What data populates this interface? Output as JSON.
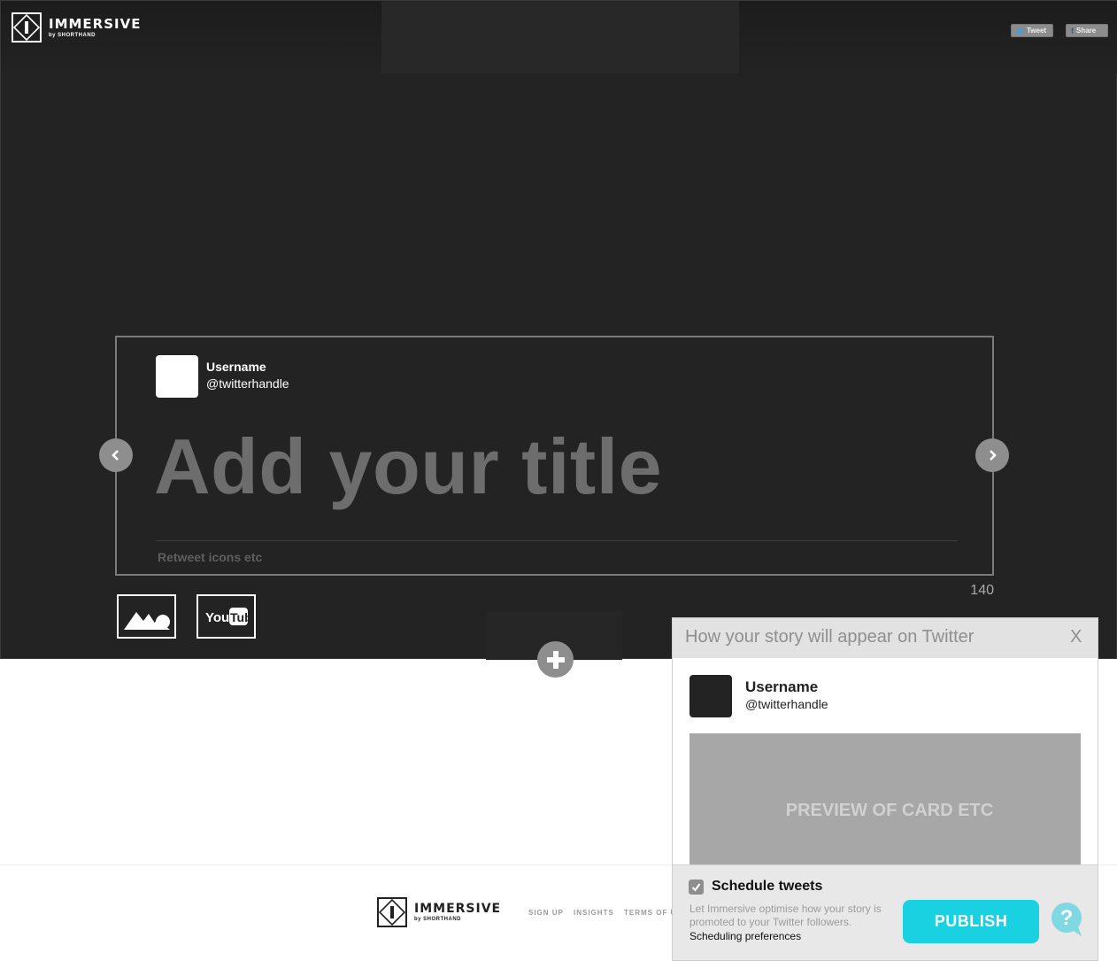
{
  "brand": {
    "name": "IMMERSIVE",
    "byline": "by SHORTHAND"
  },
  "header": {
    "tweet_label": "Tweet",
    "share_label": "Share"
  },
  "editor": {
    "username": "Username",
    "handle": "@twitterhandle",
    "title_placeholder": "Add your title",
    "footer_text": "Retweet icons etc",
    "char_count": "140",
    "youtube_label": "YouTube"
  },
  "footer": {
    "links": [
      "SIGN UP",
      "INSIGHTS",
      "TERMS OF U"
    ]
  },
  "twitter_panel": {
    "title": "How your story will appear on Twitter",
    "close_label": "X",
    "username": "Username",
    "handle": "@twitterhandle",
    "preview_text": "PREVIEW OF CARD ETC",
    "schedule_label": "Schedule tweets",
    "schedule_checked": true,
    "schedule_description": "Let Immersive optimise how your story is promoted to your Twitter followers.",
    "schedule_link": "Scheduling preferences",
    "publish_label": "PUBLISH"
  },
  "colors": {
    "stage_bg": "#232323",
    "accent": "#19d1e0",
    "muted_gray": "#8e8e8e"
  }
}
